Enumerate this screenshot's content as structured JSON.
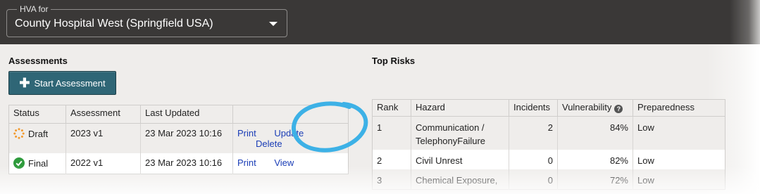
{
  "hva": {
    "label": "HVA for",
    "selected": "County Hospital West (Springfield USA)"
  },
  "assessments": {
    "title": "Assessments",
    "start_button": "Start Assessment",
    "columns": [
      "Status",
      "Assessment",
      "Last Updated",
      ""
    ],
    "rows": [
      {
        "status": "Draft",
        "assessment": "2023 v1",
        "updated": "23 Mar 2023 10:16",
        "actions": [
          "Print",
          "Update",
          "Delete"
        ]
      },
      {
        "status": "Final",
        "assessment": "2022 v1",
        "updated": "23 Mar 2023 10:16",
        "actions": [
          "Print",
          "View"
        ]
      }
    ]
  },
  "top_risks": {
    "title": "Top Risks",
    "columns": [
      "Rank",
      "Hazard",
      "Incidents",
      "Vulnerability",
      "Preparedness"
    ],
    "rows": [
      {
        "rank": "1",
        "hazard_line1": "Communication /",
        "hazard_line2": "TelephonyFailure",
        "incidents": "2",
        "vulnerability": "84%",
        "preparedness": "Low"
      },
      {
        "rank": "2",
        "hazard": "Civil Unrest",
        "incidents": "0",
        "vulnerability": "82%",
        "preparedness": "Low"
      },
      {
        "rank": "3",
        "hazard": "Chemical Exposure,",
        "incidents": "0",
        "vulnerability": "72%",
        "preparedness": "Low"
      }
    ]
  },
  "colors": {
    "header_bg": "#3a3837",
    "button_bg": "#2f6676",
    "link": "#1a3db6",
    "annotation_circle": "#3db1e6",
    "final_status": "#2e9b3c",
    "draft_status": "#f29a2e"
  },
  "icons": {
    "dropdown": "chevron-down-icon",
    "start": "plus-icon",
    "draft": "spinner-icon",
    "final": "check-circle-icon",
    "vulnerability_help": "help-icon"
  }
}
